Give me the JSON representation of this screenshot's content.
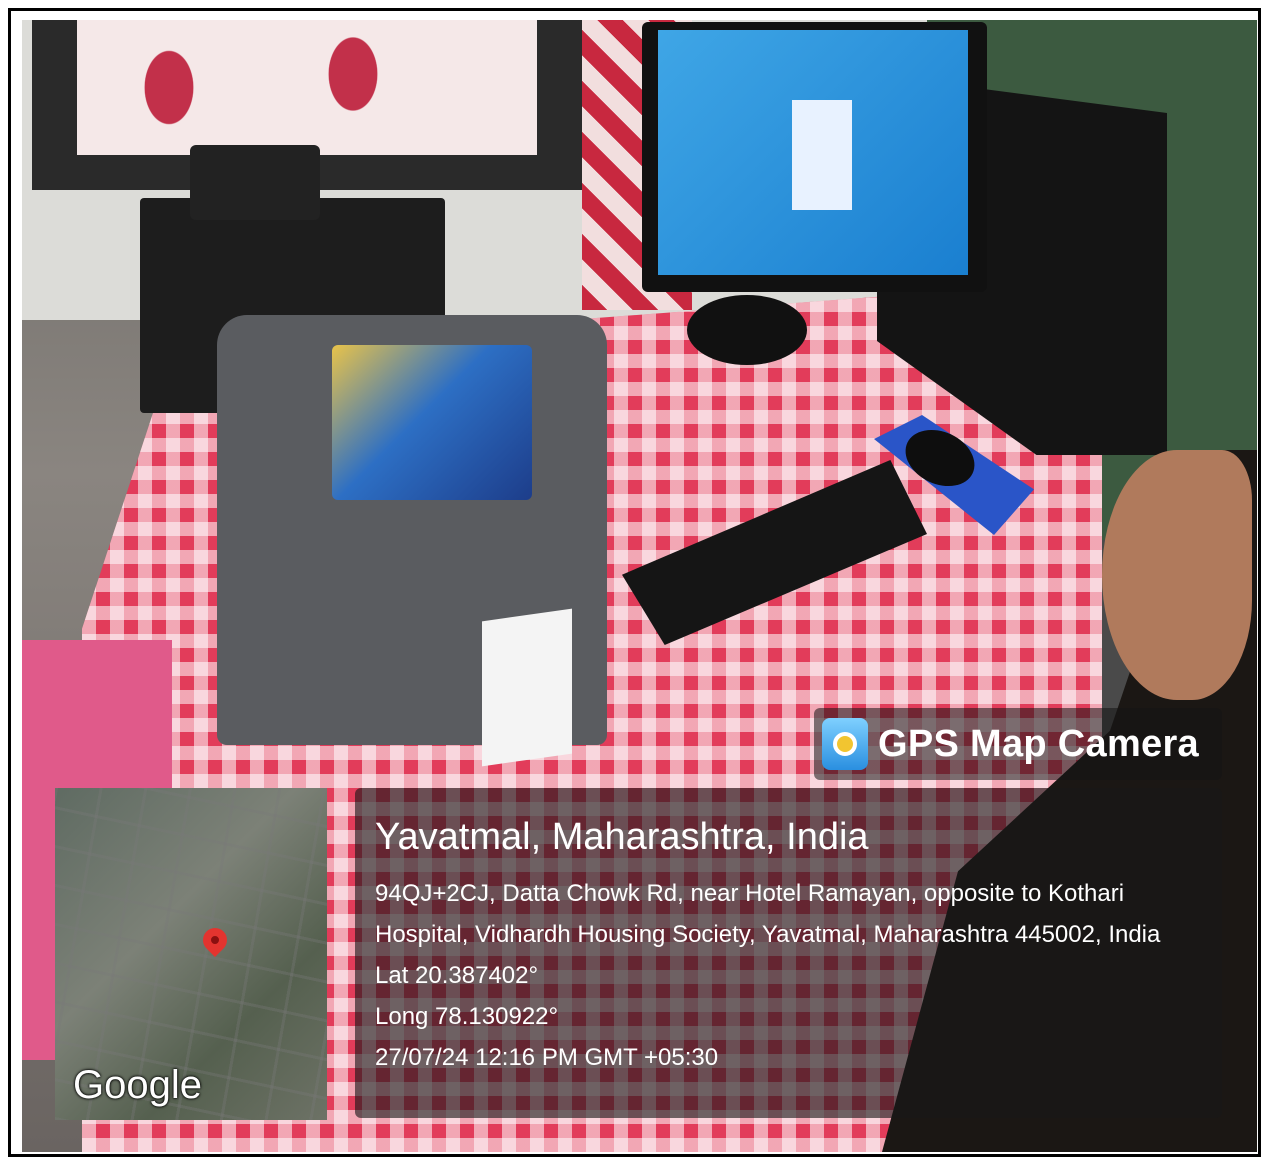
{
  "watermark": {
    "app_name": "GPS Map Camera",
    "app_icon": "gps-camera-icon",
    "map_brand": "Google",
    "place": "Yavatmal, Maharashtra, India",
    "address_line_1": "94QJ+2CJ, Datta Chowk Rd, near Hotel Ramayan, opposite to Kothari",
    "address_line_2": "Hospital, Vidhardh Housing Society, Yavatmal, Maharashtra 445002, India",
    "latitude": "Lat 20.387402°",
    "longitude": "Long 78.130922°",
    "timestamp": "27/07/24 12:16 PM GMT +05:30"
  },
  "colors": {
    "pin": "#e3342f",
    "tablecloth": "#e23c5a",
    "screen": "#1a7fd0"
  }
}
